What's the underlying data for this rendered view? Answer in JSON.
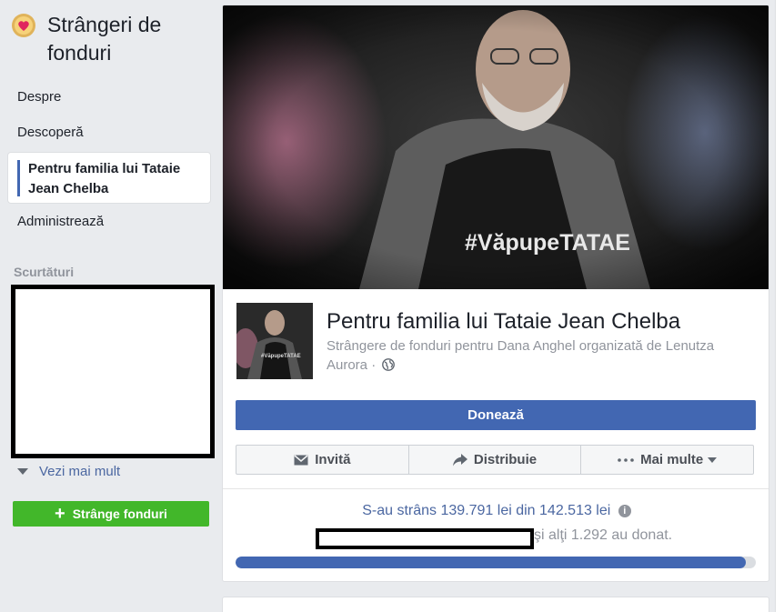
{
  "sidebar": {
    "app_title": "Strângeri de fonduri",
    "nav": [
      "Despre",
      "Descoperă",
      "Pentru familia lui Tataie Jean Chelba",
      "Administrează"
    ],
    "shortcuts_label": "Scurtături",
    "see_more": "Vezi mai mult",
    "create_button": "Strânge fonduri"
  },
  "fundraiser": {
    "cover_text": "#VăpupeTATAE",
    "thumb_text": "#VăpupeTATAE",
    "title": "Pentru familia lui Tataie Jean Chelba",
    "subtitle": "Strângere de fonduri pentru Dana Anghel organizată de Lenutza Aurora ·",
    "donate_button": "Donează",
    "actions": {
      "invite": "Invită",
      "share": "Distribuie",
      "more": "Mai multe"
    },
    "raised_text": "S-au strâns 139.791 lei din 142.513 lei",
    "donors_text": "şi alţi 1.292 au donat.",
    "progress_fraction": 0.981
  },
  "colors": {
    "accent": "#4267b2",
    "green": "#42b72a",
    "link": "#4b67a1"
  }
}
